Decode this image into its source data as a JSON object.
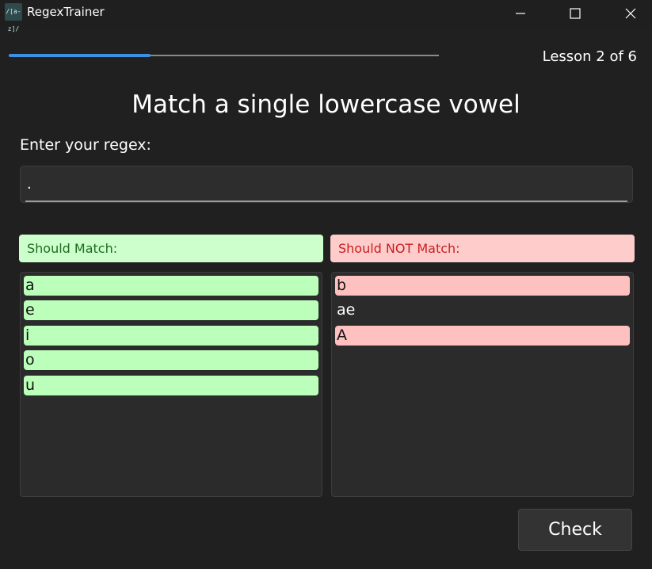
{
  "window": {
    "title": "RegexTrainer",
    "icon_text": "/[a-z]/"
  },
  "progress": {
    "lesson_label": "Lesson 2 of 6",
    "fraction": 0.33
  },
  "lesson": {
    "title": "Match a single lowercase vowel"
  },
  "regex": {
    "label": "Enter your regex:",
    "value": "."
  },
  "should_match": {
    "header": "Should Match:",
    "items": [
      "a",
      "e",
      "i",
      "o",
      "u"
    ],
    "item_states": [
      "pass",
      "pass",
      "pass",
      "pass",
      "pass"
    ]
  },
  "should_not_match": {
    "header": "Should NOT Match:",
    "items": [
      "b",
      "ae",
      "A"
    ],
    "item_states": [
      "fail",
      "pass",
      "fail"
    ]
  },
  "actions": {
    "check_label": "Check"
  },
  "colors": {
    "accent": "#3d8fe0",
    "match_bg": "#ccffcc",
    "match_text": "#1f6b1f",
    "nomatch_bg": "#ffcccc",
    "nomatch_text": "#c81e1e",
    "item_pass_green": "#bbffbb",
    "item_fail_red": "#ffc0c0"
  }
}
